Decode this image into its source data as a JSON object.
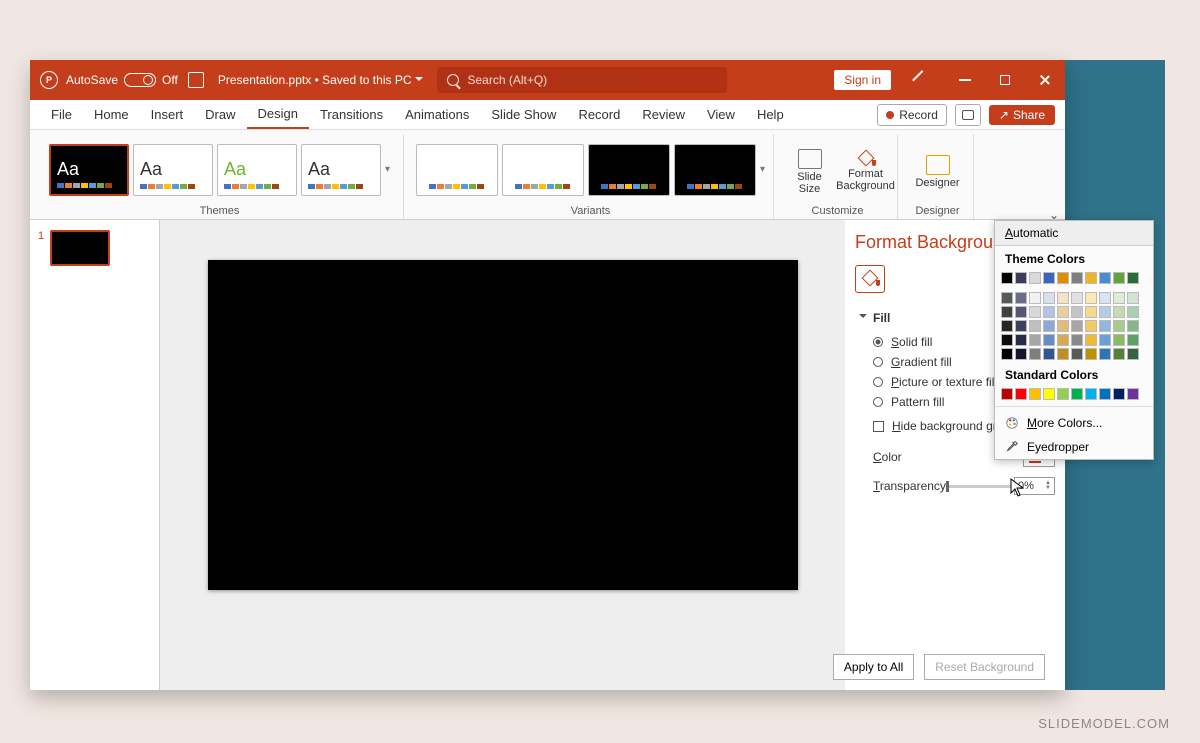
{
  "titlebar": {
    "autosave": "AutoSave",
    "autosave_state": "Off",
    "title": "Presentation.pptx • Saved to this PC",
    "search_placeholder": "Search (Alt+Q)",
    "signin": "Sign in"
  },
  "menu": {
    "items": [
      "File",
      "Home",
      "Insert",
      "Draw",
      "Design",
      "Transitions",
      "Animations",
      "Slide Show",
      "Record",
      "Review",
      "View",
      "Help"
    ],
    "active_index": 4,
    "record": "Record",
    "share": "Share"
  },
  "ribbon": {
    "groups": {
      "themes": "Themes",
      "variants": "Variants",
      "customize": "Customize",
      "designer": "Designer"
    },
    "customize": {
      "slide_size": "Slide\nSize",
      "format_background": "Format\nBackground"
    },
    "designer_btn": "Designer",
    "theme_thumbs": [
      {
        "bg": "#000",
        "fg": "#fff"
      },
      {
        "bg": "#fff",
        "fg": "#333"
      },
      {
        "bg": "#fff",
        "fg": "#6fb52e"
      },
      {
        "bg": "#fff",
        "fg": "#333"
      }
    ],
    "stripe_colors": [
      "#4472c4",
      "#ed7d31",
      "#a5a5a5",
      "#ffc000",
      "#5b9bd5",
      "#70ad47",
      "#9e480e"
    ],
    "variant_bg": [
      "#fff",
      "#fff",
      "#000",
      "#000"
    ]
  },
  "thumbs": {
    "index": "1"
  },
  "pane": {
    "title": "Format Background",
    "section": "Fill",
    "options": {
      "solid": "Solid fill",
      "gradient": "Gradient fill",
      "picture": "Picture or texture fill",
      "pattern": "Pattern fill",
      "hide": "Hide background graphics"
    },
    "color_label": "Color",
    "transparency_label": "Transparency",
    "transparency_value": "0%",
    "apply": "Apply to All",
    "reset": "Reset Background"
  },
  "colorpop": {
    "automatic": "Automatic",
    "theme_header": "Theme Colors",
    "theme_row1": [
      "#000000",
      "#3b3b5b",
      "#d9d9d9",
      "#3a66c3",
      "#e08e00",
      "#7f7f7f",
      "#f0b429",
      "#4e8ad1",
      "#62a33b",
      "#2a6b36"
    ],
    "shade_rows": [
      [
        "#595959",
        "#6b6b8a",
        "#f2f2f2",
        "#d6e0f0",
        "#f6e2c4",
        "#e0e0e0",
        "#fbe8b7",
        "#d7e5f3",
        "#e0edd6",
        "#d2e3d5"
      ],
      [
        "#404040",
        "#555577",
        "#d9d9d9",
        "#b0c4e4",
        "#eccf9e",
        "#c4c4c4",
        "#f6d98d",
        "#b3cee9",
        "#c4dcb0",
        "#abcdb0"
      ],
      [
        "#262626",
        "#3f3f60",
        "#bfbfbf",
        "#8aa8d8",
        "#e2bc78",
        "#a6a6a6",
        "#f2ca63",
        "#8fb7df",
        "#a7cb8b",
        "#84b78b"
      ],
      [
        "#0d0d0d",
        "#292949",
        "#a6a6a6",
        "#648ccb",
        "#d8a952",
        "#898989",
        "#edbb39",
        "#6aa0d5",
        "#8bba65",
        "#5da166"
      ],
      [
        "#000000",
        "#14142e",
        "#7f7f7f",
        "#2f5597",
        "#bf8f23",
        "#595959",
        "#bf9000",
        "#2e75b6",
        "#548235",
        "#386141"
      ]
    ],
    "standard_header": "Standard Colors",
    "standard": [
      "#c00000",
      "#ff0000",
      "#ffc000",
      "#ffff00",
      "#92d050",
      "#00b050",
      "#00b0f0",
      "#0070c0",
      "#002060",
      "#7030a0"
    ],
    "more": "More Colors...",
    "eyedropper": "Eyedropper"
  },
  "watermark": "SLIDEMODEL.COM"
}
